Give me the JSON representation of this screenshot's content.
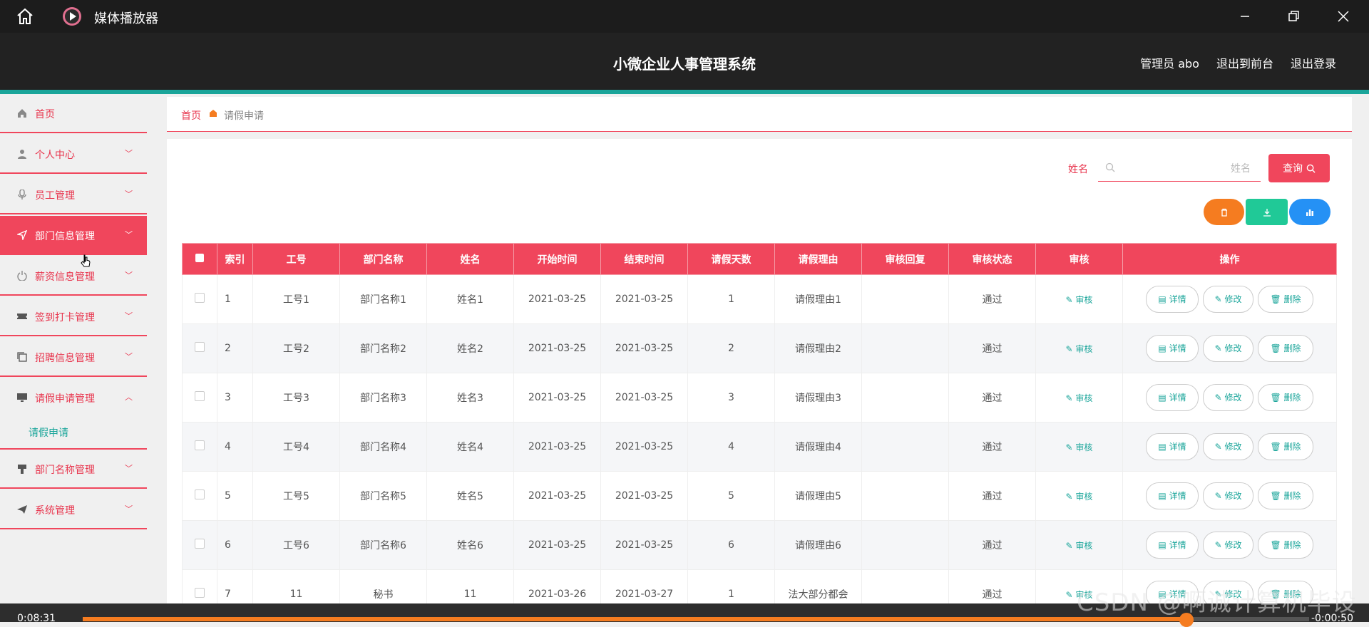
{
  "window": {
    "title": "媒体播放器"
  },
  "header": {
    "system_name": "小微企业人事管理系统",
    "user": "管理员 abo",
    "to_front": "退出到前台",
    "logout": "退出登录"
  },
  "sidebar": {
    "items": [
      {
        "label": "首页",
        "icon": "home-icon"
      },
      {
        "label": "个人中心",
        "icon": "user-icon"
      },
      {
        "label": "员工管理",
        "icon": "microphone-icon"
      },
      {
        "label": "部门信息管理",
        "icon": "send-icon",
        "active": true
      },
      {
        "label": "薪资信息管理",
        "icon": "power-icon"
      },
      {
        "label": "签到打卡管理",
        "icon": "ticket-icon"
      },
      {
        "label": "招聘信息管理",
        "icon": "copy-icon"
      },
      {
        "label": "请假申请管理",
        "icon": "monitor-icon",
        "expanded": true
      },
      {
        "label": "部门名称管理",
        "icon": "brush-icon"
      },
      {
        "label": "系统管理",
        "icon": "paper-plane-icon"
      }
    ],
    "submenu": {
      "label": "请假申请"
    }
  },
  "breadcrumb": {
    "home": "首页",
    "current": "请假申请"
  },
  "search": {
    "label": "姓名",
    "placeholder": "姓名",
    "button": "查询"
  },
  "table": {
    "headers": [
      "索引",
      "工号",
      "部门名称",
      "姓名",
      "开始时间",
      "结束时间",
      "请假天数",
      "请假理由",
      "审核回复",
      "审核状态",
      "审核",
      "操作"
    ],
    "audit_label": "审核",
    "ops": {
      "detail": "详情",
      "edit": "修改",
      "delete": "删除"
    },
    "rows": [
      {
        "index": "1",
        "job_no": "工号1",
        "dept": "部门名称1",
        "name": "姓名1",
        "start": "2021-03-25",
        "end": "2021-03-25",
        "days": "1",
        "reason": "请假理由1",
        "reply": "",
        "status": "通过"
      },
      {
        "index": "2",
        "job_no": "工号2",
        "dept": "部门名称2",
        "name": "姓名2",
        "start": "2021-03-25",
        "end": "2021-03-25",
        "days": "2",
        "reason": "请假理由2",
        "reply": "",
        "status": "通过"
      },
      {
        "index": "3",
        "job_no": "工号3",
        "dept": "部门名称3",
        "name": "姓名3",
        "start": "2021-03-25",
        "end": "2021-03-25",
        "days": "3",
        "reason": "请假理由3",
        "reply": "",
        "status": "通过"
      },
      {
        "index": "4",
        "job_no": "工号4",
        "dept": "部门名称4",
        "name": "姓名4",
        "start": "2021-03-25",
        "end": "2021-03-25",
        "days": "4",
        "reason": "请假理由4",
        "reply": "",
        "status": "通过"
      },
      {
        "index": "5",
        "job_no": "工号5",
        "dept": "部门名称5",
        "name": "姓名5",
        "start": "2021-03-25",
        "end": "2021-03-25",
        "days": "5",
        "reason": "请假理由5",
        "reply": "",
        "status": "通过"
      },
      {
        "index": "6",
        "job_no": "工号6",
        "dept": "部门名称6",
        "name": "姓名6",
        "start": "2021-03-25",
        "end": "2021-03-25",
        "days": "6",
        "reason": "请假理由6",
        "reply": "",
        "status": "通过"
      },
      {
        "index": "7",
        "job_no": "11",
        "dept": "秘书",
        "name": "11",
        "start": "2021-03-26",
        "end": "2021-03-27",
        "days": "1",
        "reason": "法大部分都会",
        "reply": "",
        "status": "通过"
      }
    ]
  },
  "player": {
    "elapsed": "0:08:31",
    "remaining": "-0:00:50",
    "progress": 0.9
  },
  "watermark": "CSDN @啊诚计算机毕设",
  "colors": {
    "accent": "#f0465c",
    "teal": "#1aa59a",
    "orange": "#f57c20",
    "blue": "#2591f5"
  }
}
